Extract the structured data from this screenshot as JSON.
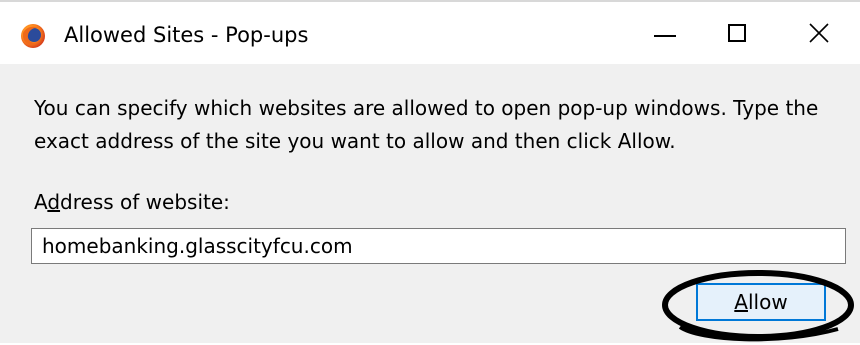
{
  "window": {
    "title": "Allowed Sites - Pop-ups",
    "icon": "firefox-icon",
    "controls": {
      "minimize": "minimize-icon",
      "maximize": "maximize-icon",
      "close": "close-icon"
    }
  },
  "dialog": {
    "description": "You can specify which websites are allowed to open pop-up windows. Type the exact address of the site you want to allow and then click Allow.",
    "address_label": {
      "prefix": "A",
      "mnemonic": "d",
      "suffix": "dress of website:"
    },
    "address_value": "homebanking.glasscityfcu.com",
    "allow_button": {
      "mnemonic": "A",
      "suffix": "llow"
    }
  },
  "colors": {
    "accent": "#0078d7",
    "window_bg": "#f0f0f0",
    "titlebar_bg": "#ffffff",
    "annotation_ellipse": "#000000"
  }
}
